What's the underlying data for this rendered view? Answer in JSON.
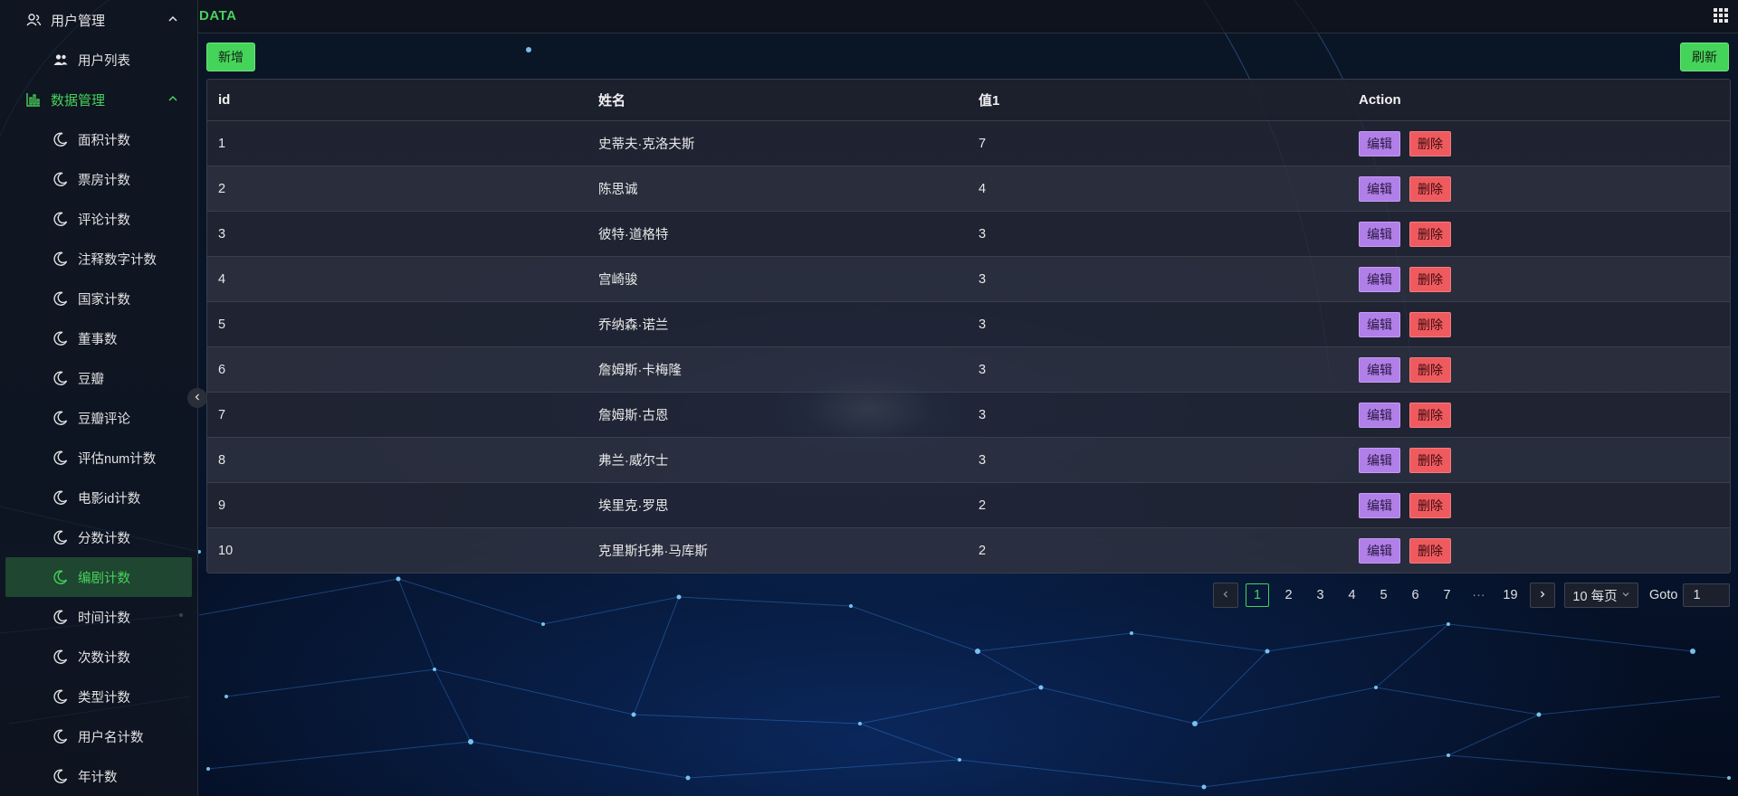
{
  "colors": {
    "accent": "#48d15b",
    "edit": "#b07fe8",
    "delete": "#ef5a5f"
  },
  "header": {
    "brand": "DATA",
    "apps_icon": "grid-icon"
  },
  "sidebar": {
    "groups": [
      {
        "label": "用户管理",
        "icon": "users-icon",
        "items": [
          {
            "label": "用户列表",
            "icon": "user-group-icon"
          }
        ]
      },
      {
        "label": "数据管理",
        "icon": "chart-icon",
        "items": [
          {
            "label": "面积计数",
            "icon": "moon-icon"
          },
          {
            "label": "票房计数",
            "icon": "moon-icon"
          },
          {
            "label": "评论计数",
            "icon": "moon-icon"
          },
          {
            "label": "注释数字计数",
            "icon": "moon-icon"
          },
          {
            "label": "国家计数",
            "icon": "moon-icon"
          },
          {
            "label": "董事数",
            "icon": "moon-icon"
          },
          {
            "label": "豆瓣",
            "icon": "moon-icon"
          },
          {
            "label": "豆瓣评论",
            "icon": "moon-icon"
          },
          {
            "label": "评估num计数",
            "icon": "moon-icon"
          },
          {
            "label": "电影id计数",
            "icon": "moon-icon"
          },
          {
            "label": "分数计数",
            "icon": "moon-icon"
          },
          {
            "label": "编剧计数",
            "icon": "moon-icon"
          },
          {
            "label": "时间计数",
            "icon": "moon-icon"
          },
          {
            "label": "次数计数",
            "icon": "moon-icon"
          },
          {
            "label": "类型计数",
            "icon": "moon-icon"
          },
          {
            "label": "用户名计数",
            "icon": "moon-icon"
          },
          {
            "label": "年计数",
            "icon": "moon-icon"
          }
        ]
      }
    ],
    "selected": "编剧计数"
  },
  "toolbar": {
    "add_label": "新增",
    "refresh_label": "刷新"
  },
  "table": {
    "columns": [
      "id",
      "姓名",
      "值1",
      "Action"
    ],
    "rows": [
      {
        "id": "1",
        "name": "史蒂夫·克洛夫斯",
        "value": "7"
      },
      {
        "id": "2",
        "name": "陈思诚",
        "value": "4"
      },
      {
        "id": "3",
        "name": "彼特·道格特",
        "value": "3"
      },
      {
        "id": "4",
        "name": "宫崎骏",
        "value": "3"
      },
      {
        "id": "5",
        "name": "乔纳森·诺兰",
        "value": "3"
      },
      {
        "id": "6",
        "name": "詹姆斯·卡梅隆",
        "value": "3"
      },
      {
        "id": "7",
        "name": "詹姆斯·古恩",
        "value": "3"
      },
      {
        "id": "8",
        "name": "弗兰·威尔士",
        "value": "3"
      },
      {
        "id": "9",
        "name": "埃里克·罗思",
        "value": "2"
      },
      {
        "id": "10",
        "name": "克里斯托弗·马库斯",
        "value": "2"
      }
    ],
    "edit_label": "编辑",
    "delete_label": "删除"
  },
  "pagination": {
    "pages": [
      "1",
      "2",
      "3",
      "4",
      "5",
      "6",
      "7",
      "···",
      "19"
    ],
    "current": "1",
    "page_size": "10 每页",
    "goto_label": "Goto",
    "goto_value": "1"
  }
}
